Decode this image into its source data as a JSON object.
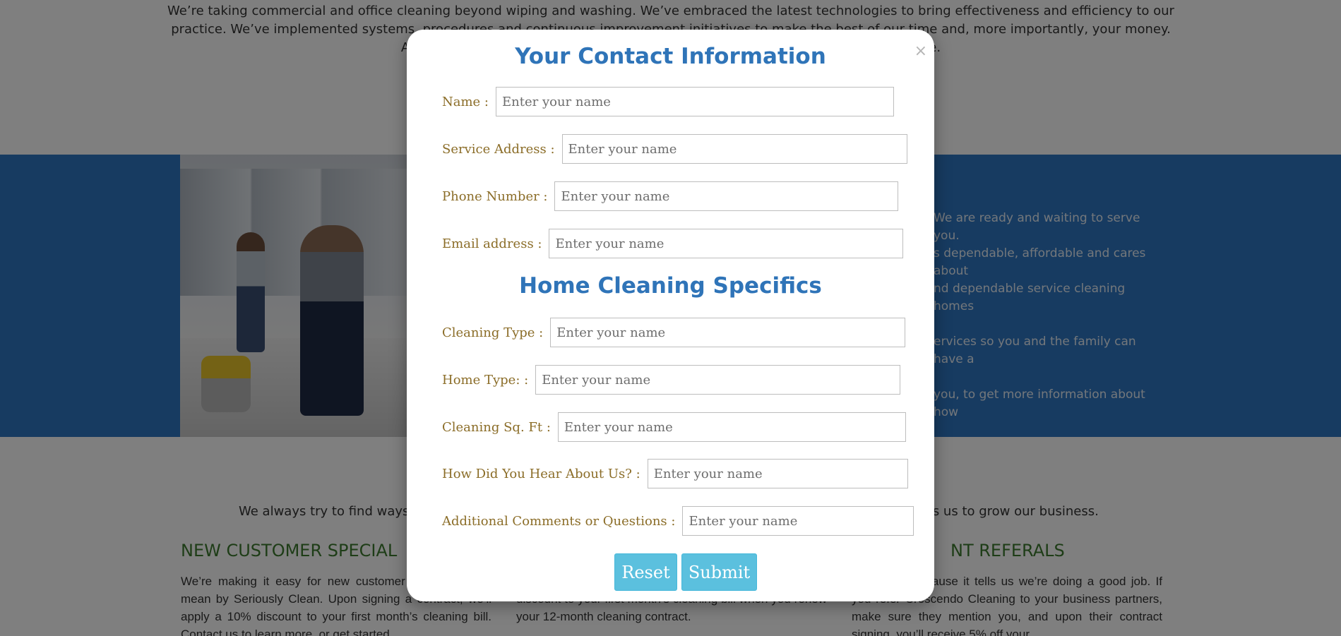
{
  "background": {
    "intro_text": "We’re taking commercial and office cleaning beyond wiping and washing. We’ve embraced the latest technologies to bring effectiveness and efficiency to our practice. We’ve implemented systems, procedures and continuous improvement initiatives to make the best of our time and, more importantly, your money. And we’re committed to reducing our impact on the environment wherever possible.",
    "band_lines": [
      "We are ready and waiting to serve you.",
      "s dependable, affordable and cares about",
      "nd dependable service cleaning homes",
      "",
      "ervices so you and the family can have a",
      "",
      "you, to get more information about how"
    ],
    "lower_intro_left": "We always try to find ways to",
    "lower_intro_right": "ngs us to grow our business.",
    "heading_left": "NEW CUSTOMER SPECIAL",
    "heading_right": "NT REFERALS",
    "col_left": "We’re making it easy for new customer hand what we mean by Seriously Clean. Upon signing a contract, we’ll apply a 10% discount to your first month’s cleaning bill. Contact us to learn more, or get started",
    "col_mid": "of appreciation to current customers, we’ll apply a 10% discount to your first month’s cleaning bill when you renew your 12-month cleaning contract.",
    "col_right": "e referrals because it tells us we’re doing a good job. If you refer Crescendo Cleaning to your business partners, make sure they mention you, and upon their contract signing, you’ll receive 5% off your"
  },
  "modal": {
    "close_symbol": "×",
    "contact_title": "Your Contact Information",
    "specifics_title": "Home Cleaning Specifics",
    "fields": [
      {
        "label": "Name :",
        "placeholder": "Enter your name"
      },
      {
        "label": "Service Address :",
        "placeholder": "Enter your name"
      },
      {
        "label": "Phone Number :",
        "placeholder": "Enter your name"
      },
      {
        "label": "Email address :",
        "placeholder": "Enter your name"
      },
      {
        "label": "Cleaning Type :",
        "placeholder": "Enter your name"
      },
      {
        "label": "Home Type: :",
        "placeholder": "Enter your name"
      },
      {
        "label": "Cleaning Sq. Ft :",
        "placeholder": "Enter your name"
      },
      {
        "label": "How Did You Hear About Us? :",
        "placeholder": "Enter your name"
      },
      {
        "label": "Additional Comments or Questions :",
        "placeholder": "Enter your name"
      }
    ],
    "reset_label": "Reset",
    "submit_label": "Submit"
  },
  "colors": {
    "band_blue": "#2f76c2",
    "title_blue": "#2f74b8",
    "label_gold": "#8b6d28",
    "button_cyan": "#5bc0de",
    "heading_green": "#3c7a2e"
  }
}
